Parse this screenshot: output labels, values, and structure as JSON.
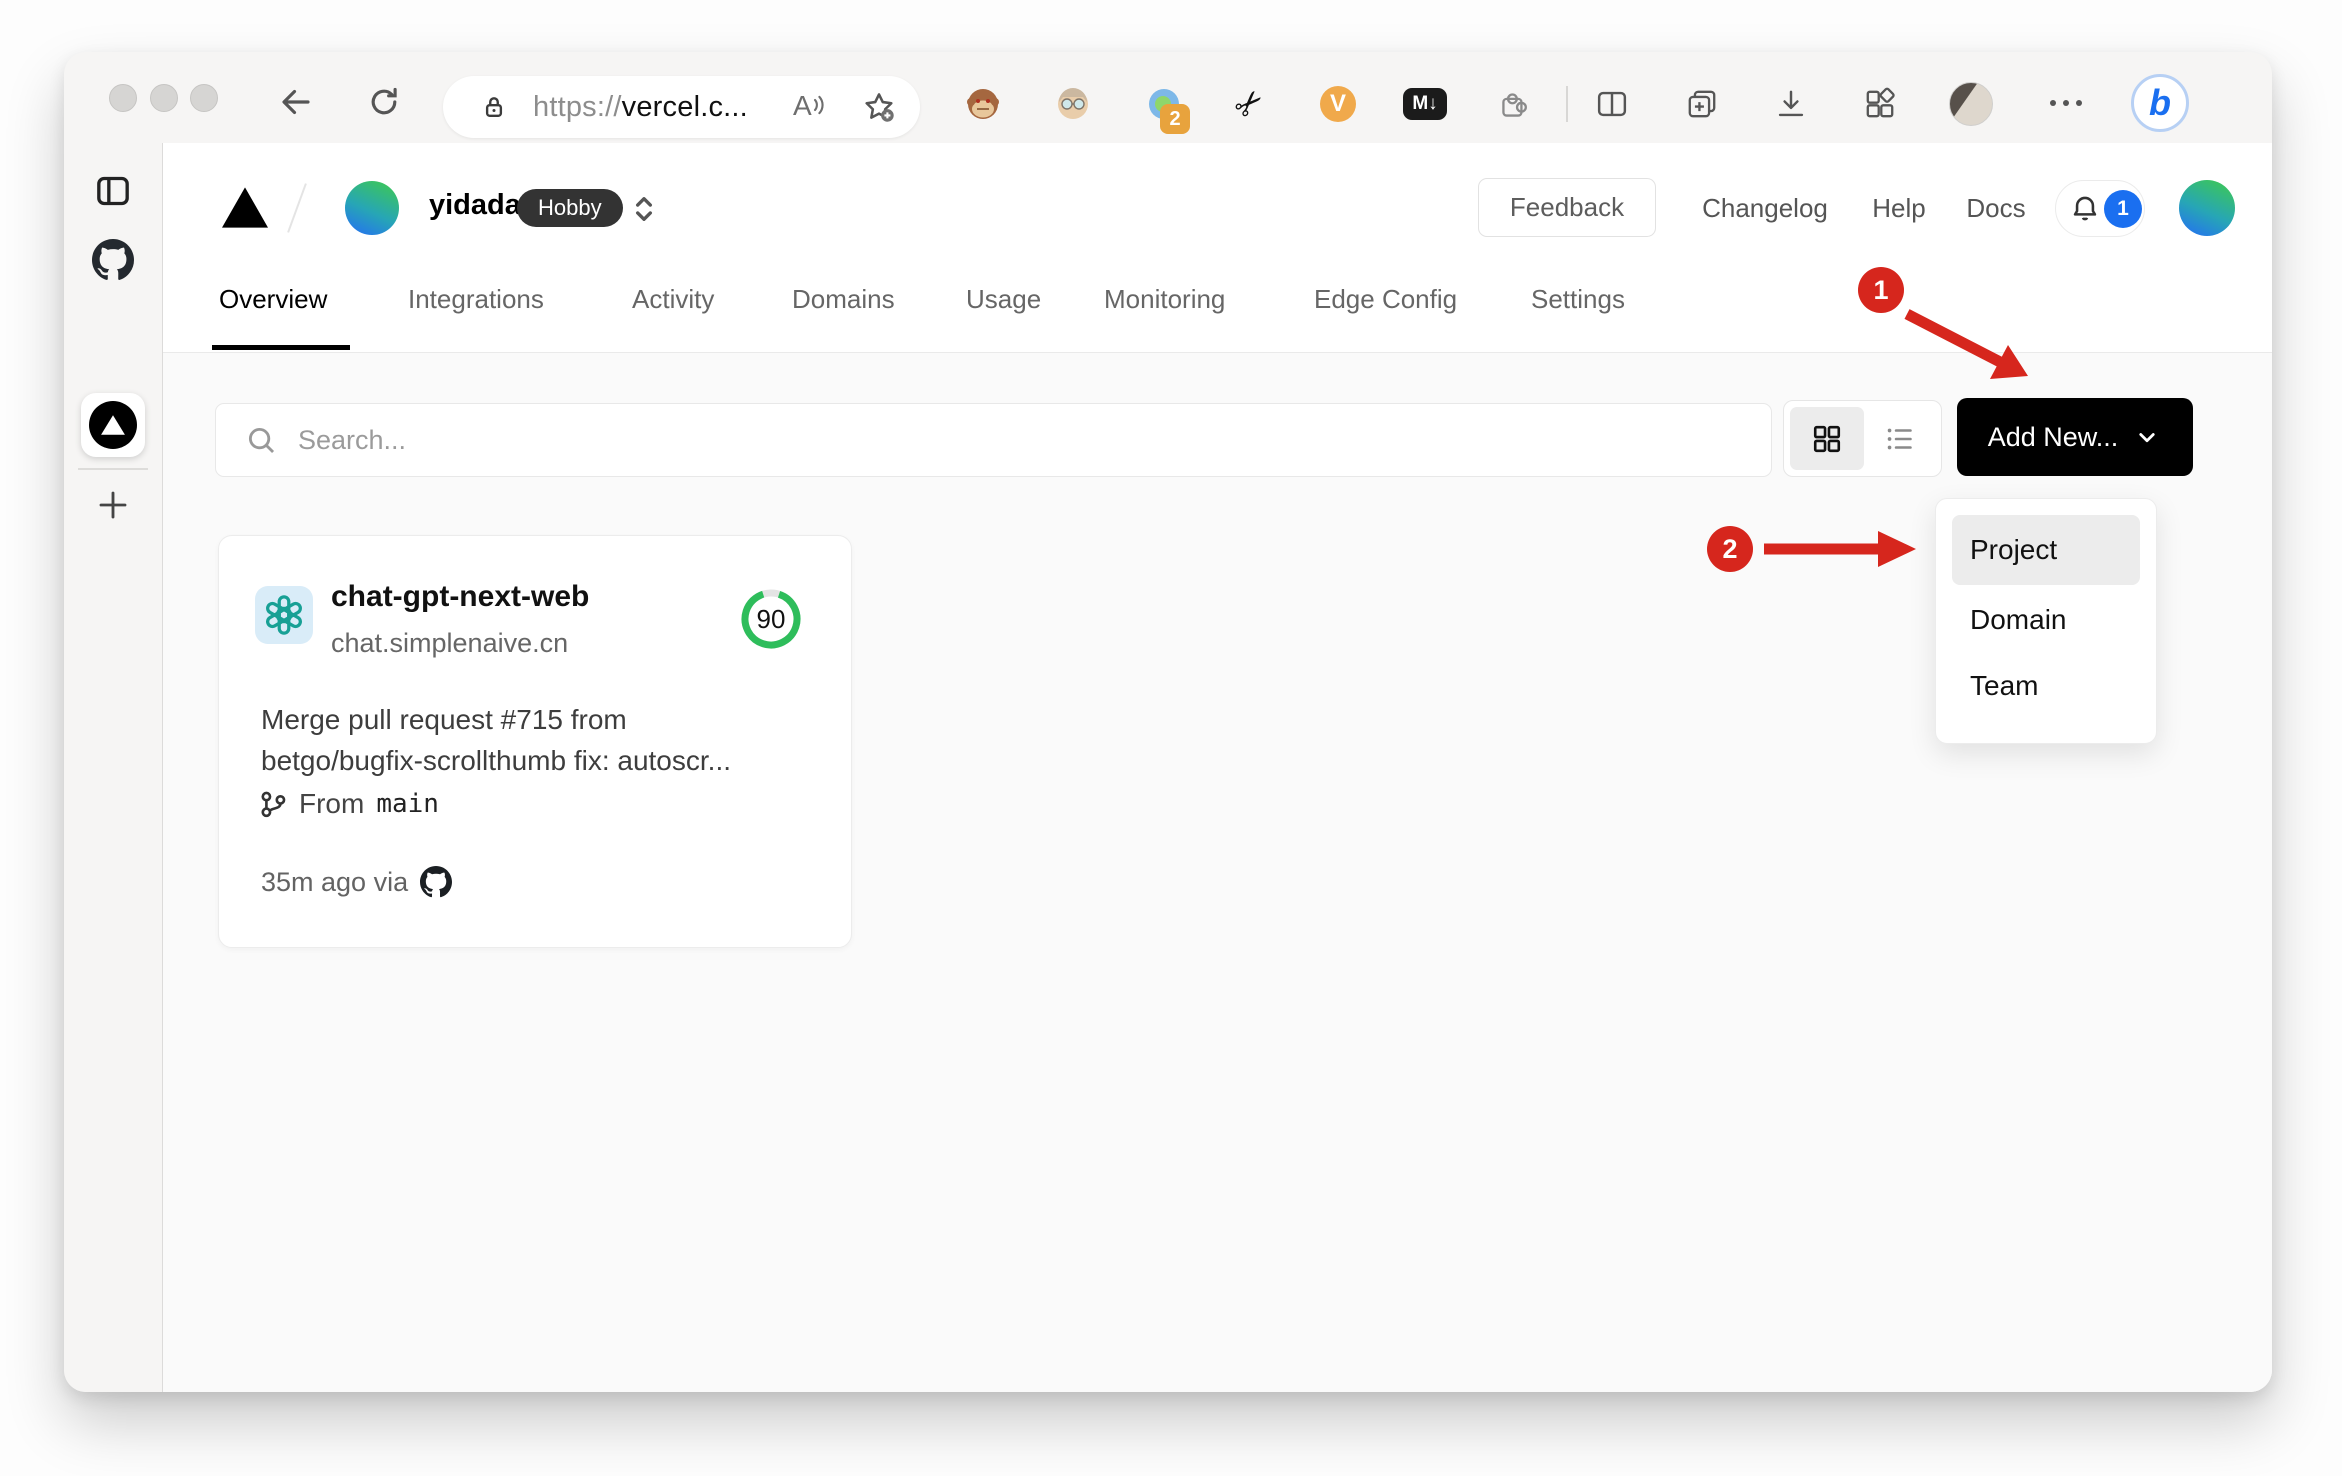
{
  "browser": {
    "url_prefix": "https://",
    "url_host": "vercel.c...",
    "read_aloud_label": "A",
    "scissors_glyph": "✂",
    "extension_badge": "2",
    "video_ext_label": "V",
    "markdown_ext_label": "M↓",
    "bing_label": "b"
  },
  "vercel": {
    "team_name": "yidadaa",
    "plan_badge": "Hobby",
    "nav": {
      "feedback": "Feedback",
      "changelog": "Changelog",
      "help": "Help",
      "docs": "Docs"
    },
    "notification_count": "1"
  },
  "tabs": [
    {
      "label": "Overview",
      "active": true
    },
    {
      "label": "Integrations",
      "active": false
    },
    {
      "label": "Activity",
      "active": false
    },
    {
      "label": "Domains",
      "active": false
    },
    {
      "label": "Usage",
      "active": false
    },
    {
      "label": "Monitoring",
      "active": false
    },
    {
      "label": "Edge Config",
      "active": false
    },
    {
      "label": "Settings",
      "active": false
    }
  ],
  "controls": {
    "search_placeholder": "Search...",
    "add_new": "Add New..."
  },
  "project_card": {
    "name": "chat-gpt-next-web",
    "domain": "chat.simplenaive.cn",
    "score": "90",
    "commit_lines": [
      "Merge pull request #715 from",
      "betgo/bugfix-scrollthumb fix: autoscr..."
    ],
    "branch_label": "From",
    "branch_name": "main",
    "time_ago": "35m ago via"
  },
  "add_new_menu": {
    "items": [
      {
        "label": "Project",
        "highlighted": true
      },
      {
        "label": "Domain",
        "highlighted": false
      },
      {
        "label": "Team",
        "highlighted": false
      }
    ]
  },
  "annotations": {
    "step_1": "1",
    "step_2": "2"
  },
  "colors": {
    "annotation_red": "#d6261d",
    "score_green": "#2ebd5b",
    "notification_blue": "#1a6ff0",
    "add_new_black": "#000000",
    "openai_teal": "#17a095"
  }
}
